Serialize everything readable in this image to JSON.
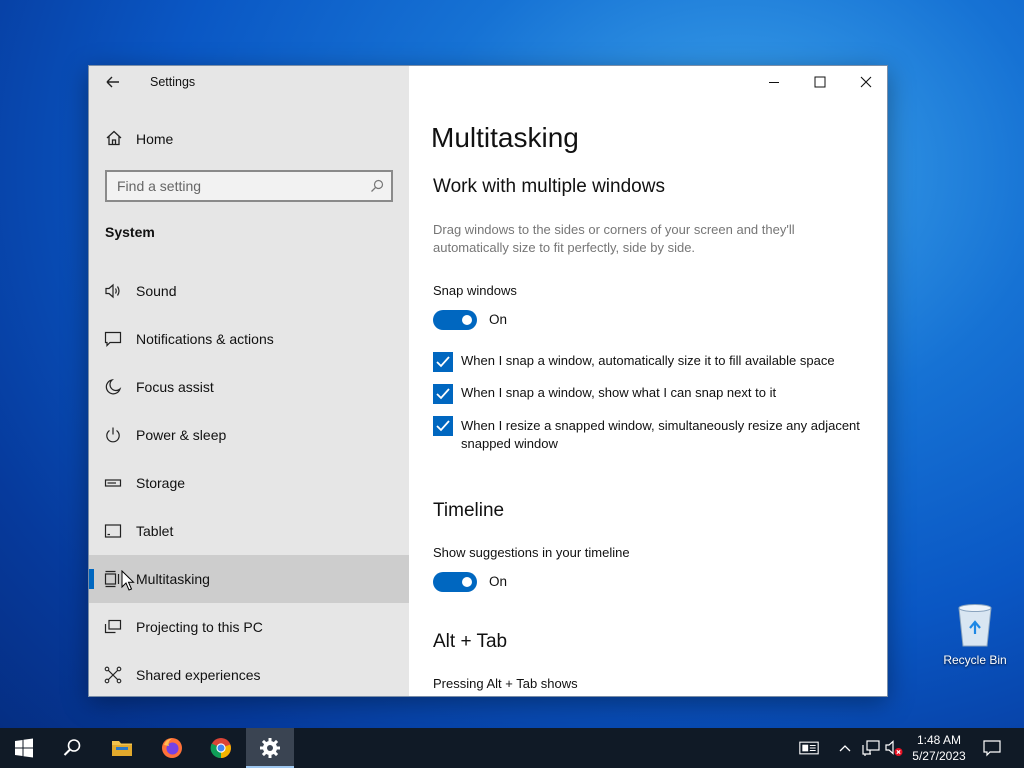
{
  "window": {
    "title": "Settings",
    "controls": {
      "minimize": "minimize",
      "maximize": "maximize",
      "close": "close"
    }
  },
  "sidebar": {
    "home": "Home",
    "search": {
      "placeholder": "Find a setting",
      "value": ""
    },
    "section": "System",
    "items": [
      {
        "label": "Sound",
        "icon": "speaker-icon"
      },
      {
        "label": "Notifications & actions",
        "icon": "notification-icon"
      },
      {
        "label": "Focus assist",
        "icon": "moon-icon"
      },
      {
        "label": "Power & sleep",
        "icon": "power-icon"
      },
      {
        "label": "Storage",
        "icon": "storage-icon"
      },
      {
        "label": "Tablet",
        "icon": "tablet-icon"
      },
      {
        "label": "Multitasking",
        "icon": "multitasking-icon",
        "active": true
      },
      {
        "label": "Projecting to this PC",
        "icon": "projecting-icon"
      },
      {
        "label": "Shared experiences",
        "icon": "shared-icon"
      }
    ]
  },
  "content": {
    "title": "Multitasking",
    "windows_section": {
      "heading": "Work with multiple windows",
      "description": "Drag windows to the sides or corners of your screen and they'll automatically size to fit perfectly, side by side.",
      "snap_label": "Snap windows",
      "snap_state": "On",
      "checkboxes": [
        {
          "label": "When I snap a window, automatically size it to fill available space",
          "checked": true
        },
        {
          "label": "When I snap a window, show what I can snap next to it",
          "checked": true
        },
        {
          "label": "When I resize a snapped window, simultaneously resize any adjacent snapped window",
          "checked": true
        }
      ]
    },
    "timeline_section": {
      "heading": "Timeline",
      "label": "Show suggestions in your timeline",
      "state": "On"
    },
    "alttab_section": {
      "heading": "Alt + Tab",
      "label": "Pressing Alt + Tab shows"
    }
  },
  "desktop": {
    "recycle_bin": "Recycle Bin"
  },
  "taskbar": {
    "apps": [
      "start",
      "search",
      "file-explorer",
      "firefox",
      "chrome",
      "settings"
    ],
    "clock": {
      "time": "1:48 AM",
      "date": "5/27/2023"
    }
  },
  "colors": {
    "accent": "#0067c0",
    "sidebar_bg": "#e6e6e6",
    "taskbar_bg": "#101a26"
  }
}
